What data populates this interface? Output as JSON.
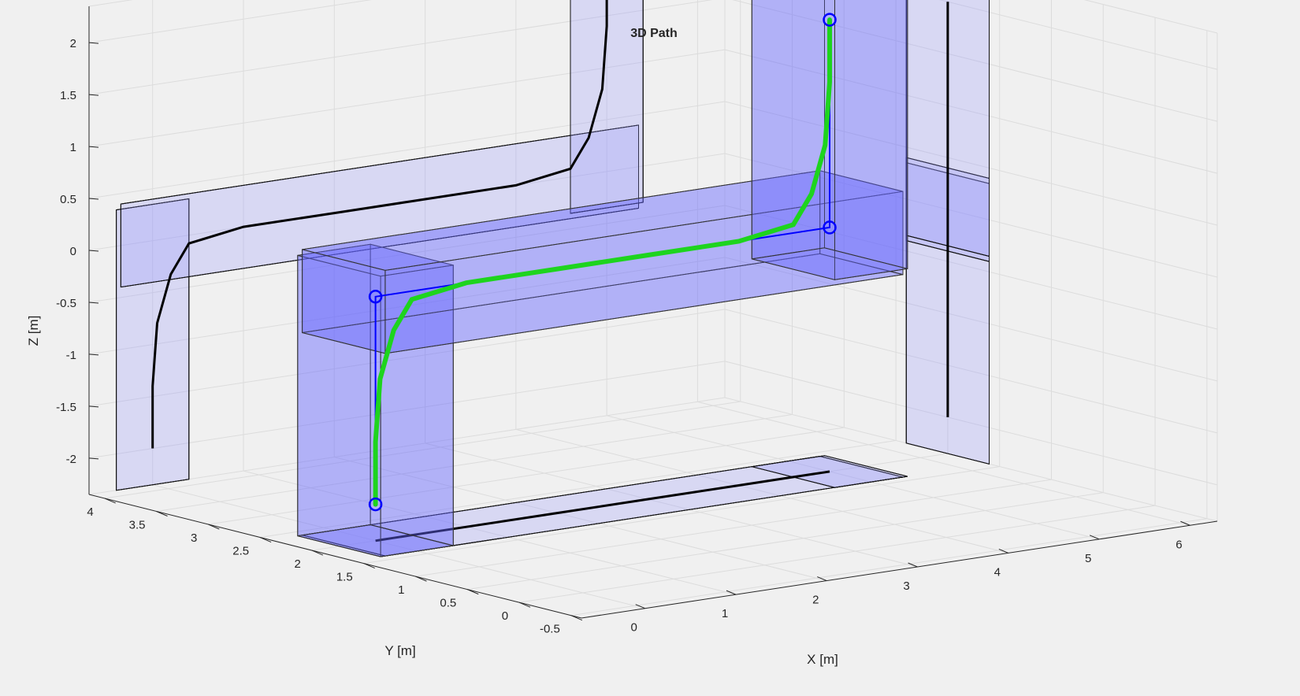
{
  "chart_data": {
    "type": "line",
    "title": "3D Path",
    "xlabel": "X [m]",
    "ylabel": "Y [m]",
    "zlabel": "Z [m]",
    "xlim": [
      -0.7,
      6.3
    ],
    "ylim": [
      -0.6,
      4.15
    ],
    "zlim": [
      -2.35,
      2.35
    ],
    "xticks": [
      "0",
      "1",
      "2",
      "3",
      "4",
      "5",
      "6"
    ],
    "yticks": [
      "-0.5",
      "0",
      "0.5",
      "1",
      "1.5",
      "2",
      "2.5",
      "3",
      "3.5",
      "4"
    ],
    "zticks": [
      "-2",
      "-1.5",
      "-1",
      "-0.5",
      "0",
      "0.5",
      "1",
      "1.5",
      "2"
    ],
    "grid": true,
    "waypoints": [
      {
        "x": 0,
        "y": 2,
        "z": -2
      },
      {
        "x": 0,
        "y": 2,
        "z": 0
      },
      {
        "x": 5,
        "y": 2,
        "z": 0
      },
      {
        "x": 5,
        "y": 2,
        "z": 2
      }
    ],
    "series": [
      {
        "x": [
          0,
          0,
          0.05,
          0.2,
          0.4,
          1,
          2,
          3,
          4,
          4.6,
          4.8,
          4.95,
          5,
          5
        ],
        "y": [
          2,
          2,
          2,
          2,
          2,
          2,
          2,
          2,
          2,
          2,
          2,
          2,
          2,
          2
        ],
        "z": [
          -2,
          -1.4,
          -0.8,
          -0.35,
          -0.08,
          0,
          0,
          0,
          0,
          0.08,
          0.35,
          0.8,
          1.4,
          2
        ]
      }
    ]
  }
}
